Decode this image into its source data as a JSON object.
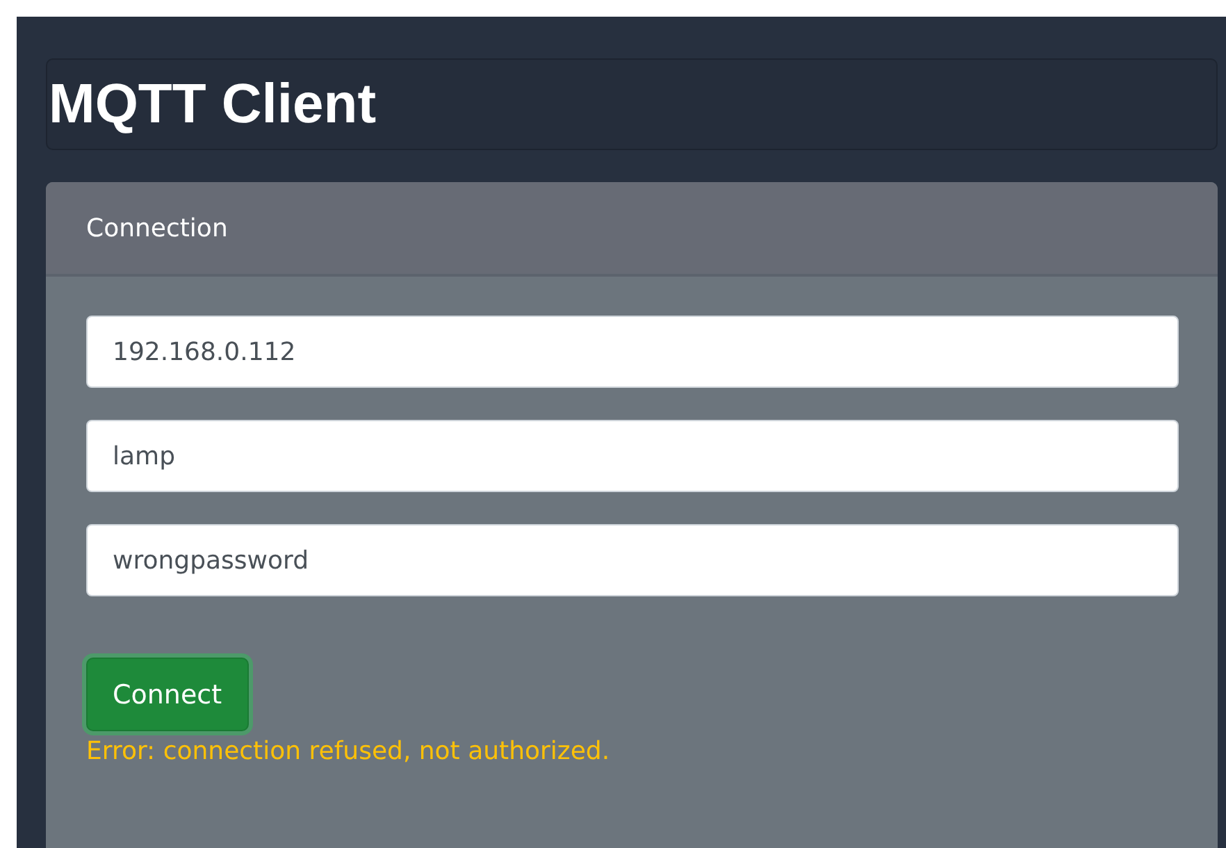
{
  "title": "MQTT Client",
  "connection": {
    "header": "Connection",
    "fields": [
      {
        "value": "192.168.0.112"
      },
      {
        "value": "lamp"
      },
      {
        "value": "wrongpassword"
      }
    ],
    "button": {
      "label": "Connect",
      "focused": true
    },
    "error": "Error: connection refused, not authorized."
  }
}
